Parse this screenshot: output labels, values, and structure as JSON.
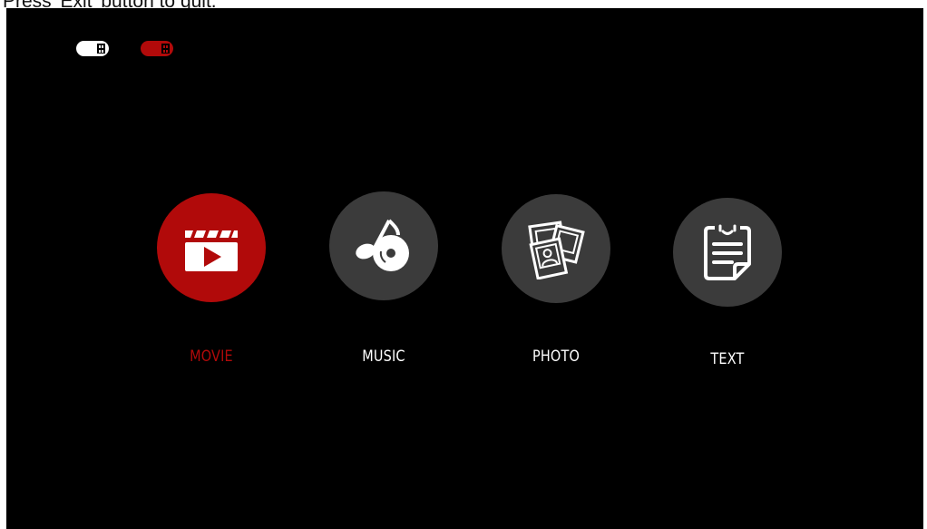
{
  "instruction": "Press 'Exit' button to quit.",
  "colors": {
    "background": "#000000",
    "tile": "#3b3b3b",
    "accent": "#b10a0a",
    "text": "#ffffff"
  },
  "drives": [
    {
      "icon": "usb-drive-icon",
      "state": "normal"
    },
    {
      "icon": "usb-drive-icon",
      "state": "selected"
    }
  ],
  "menu": {
    "selected": "MOVIE",
    "items": [
      {
        "label": "MOVIE",
        "icon": "clapperboard-play-icon"
      },
      {
        "label": "MUSIC",
        "icon": "music-note-disc-icon"
      },
      {
        "label": "PHOTO",
        "icon": "photos-icon"
      },
      {
        "label": "TEXT",
        "icon": "document-icon"
      }
    ]
  }
}
